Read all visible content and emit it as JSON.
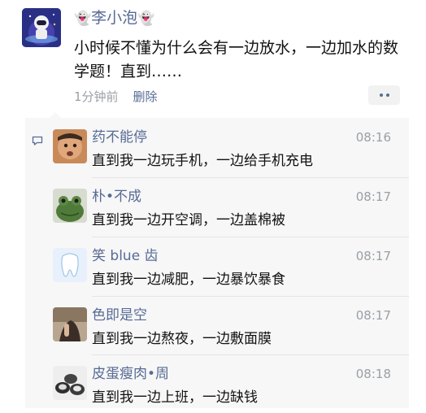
{
  "post": {
    "author_prefix": "👻",
    "author": "李小泡",
    "author_suffix": "👻",
    "text": "小时候不懂为什么会有一边放水，一边加水的数学题！直到……",
    "time": "1分钟前",
    "delete_label": "删除"
  },
  "comments": [
    {
      "name": "药不能停",
      "time": "08:16",
      "text": "直到我一边玩手机，一边给手机充电"
    },
    {
      "name": "朴•不成",
      "time": "08:17",
      "text": "直到我一边开空调，一边盖棉被"
    },
    {
      "name": "笑 blue 齿",
      "time": "08:17",
      "text": "直到我一边减肥，一边暴饮暴食"
    },
    {
      "name": "色即是空",
      "time": "08:17",
      "text": "直到我一边熬夜，一边敷面膜"
    },
    {
      "name": "皮蛋瘦肉•周",
      "time": "08:18",
      "text": "直到我一边上班，一边缺钱"
    }
  ],
  "colors": {
    "link": "#576b95",
    "muted": "#9aa0a6",
    "panel": "#f7f7f7"
  }
}
